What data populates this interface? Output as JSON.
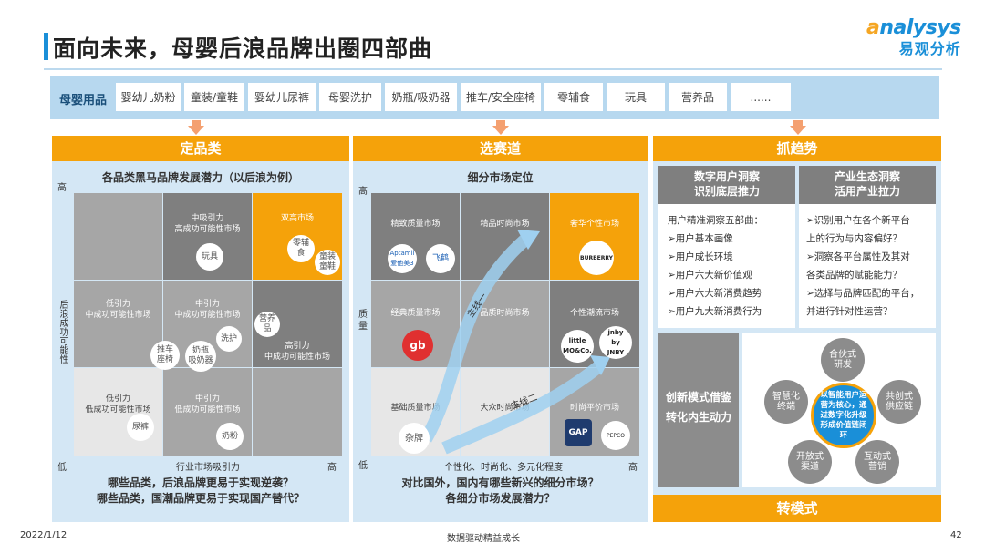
{
  "title": "面向未来，母婴后浪品牌出圈四部曲",
  "brand": {
    "en_prefix": "a",
    "en": "nalysys",
    "cn": "易观分析"
  },
  "categories": {
    "label": "母婴用品",
    "items": [
      "婴幼儿奶粉",
      "童装/童鞋",
      "婴幼儿尿裤",
      "母婴洗护",
      "奶瓶/吸奶器",
      "推车/安全座椅",
      "零辅食",
      "玩具",
      "营养品",
      "......"
    ]
  },
  "panel1": {
    "header": "定品类",
    "subtitle": "各品类黑马品牌发展潜力（以后浪为例）",
    "y_high": "高",
    "y_low": "低",
    "y_label": "后浪成功可能性",
    "x_label": "行业市场吸引力",
    "x_high": "高",
    "cells": {
      "r1c2": "中吸引力\n高成功可能性市场",
      "r1c3": "双高市场",
      "r2c1": "低引力\n中成功可能性市场",
      "r2c2": "中引力\n中成功可能性市场",
      "r2c3": "高引力\n中成功可能性市场",
      "r3c1": "低引力\n低成功可能性市场",
      "r3c2": "中引力\n低成功可能性市场"
    },
    "items": {
      "toy": "玩具",
      "food": "零辅\n食",
      "apparel": "童装\n童鞋",
      "nutrition": "营养\n品",
      "wash": "洗护",
      "stroller": "推车\n座椅",
      "bottle": "奶瓶\n吸奶器",
      "diaper": "尿裤",
      "milk": "奶粉"
    },
    "question": "哪些品类，后浪品牌更易于实现逆袭？\n哪些品类，国潮品牌更易于实现国产替代？"
  },
  "panel2": {
    "header": "选赛道",
    "subtitle": "细分市场定位",
    "y_high": "高",
    "y_low": "低",
    "y_label": "质量",
    "x_label": "个性化、时尚化、多元化程度",
    "x_high": "高",
    "cells": {
      "r1c1": "精致质量市场",
      "r1c2": "精品时尚市场",
      "r1c3": "奢华个性市场",
      "r2c1": "经典质量市场",
      "r2c2": "品质时尚市场",
      "r2c3": "个性潮流市场",
      "r3c1": "基础质量市场",
      "r3c2": "大众时尚市场",
      "r3c3": "时尚平价市场"
    },
    "line1": "主线一",
    "line2": "主线二",
    "logos": {
      "aptamil": "Aptamil\n爱他美3",
      "feihe": "飞鹤",
      "burberry": "BURBERRY",
      "gb": "gb",
      "little": "little\nMO&Co.",
      "jnby": "jnby\nby\nJNBY",
      "zapai": "杂牌",
      "gap": "GAP",
      "pepco": "PEPCO"
    },
    "question": "对比国外，国内有哪些新兴的细分市场？\n各细分市场发展潜力？"
  },
  "panel3": {
    "header": "抓趋势",
    "col1_head": "数字用户洞察\n识别底层推力",
    "col2_head": "产业生态洞察\n活用产业拉力",
    "col1_items": [
      "用户精准洞察五部曲：",
      "➢用户基本画像",
      "➢用户成长环境",
      "➢用户六大新价值观",
      "➢用户六大新消费趋势",
      "➢用户九大新消费行为"
    ],
    "col2_items": [
      "➢识别用户在各个新平台",
      "上的行为与内容偏好？",
      "➢洞察各平台属性及其对",
      "各类品牌的赋能能力？",
      "➢选择与品牌匹配的平台，",
      "并进行针对性运营？"
    ],
    "innov": "创新模式借鉴\n转化内生动力",
    "center": "以智能用户运营为核心，通过数字化升级形成价值链闭环",
    "petals": [
      "合伙式\n研发",
      "共创式\n供应链",
      "互动式\n营销",
      "开放式\n渠道",
      "智慧化\n终端"
    ],
    "footer": "转模式"
  },
  "footer": {
    "date": "2022/1/12",
    "center": "数据驱动精益成长",
    "page": "42"
  }
}
